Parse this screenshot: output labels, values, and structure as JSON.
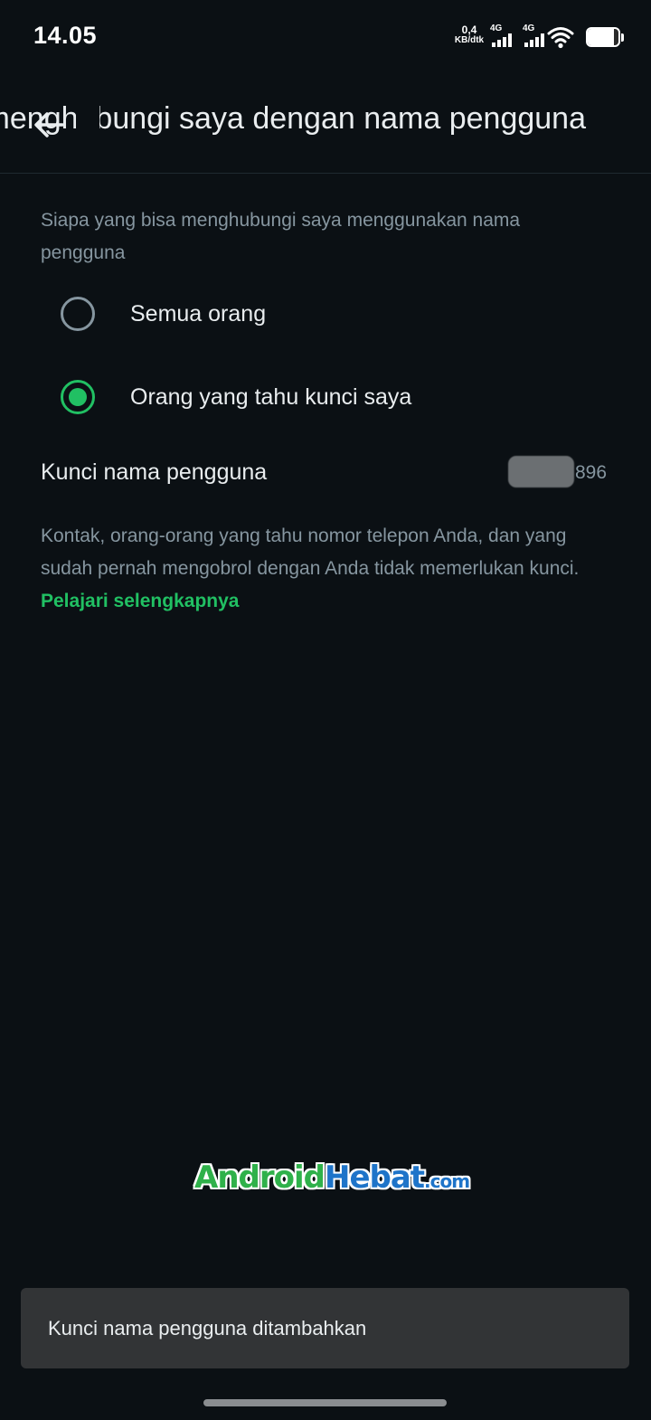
{
  "status_bar": {
    "time": "14.05",
    "net_speed_value": "0,4",
    "net_speed_unit": "KB/dtk",
    "sim1_label": "4G",
    "sim2_label": "4G",
    "battery_level_percent": 85
  },
  "app_bar": {
    "title": "Siapa yang bisa menghubungi saya dengan nama pengguna",
    "back_icon": "arrow-left-icon"
  },
  "section": {
    "description": "Siapa yang bisa menghubungi saya menggunakan nama pengguna",
    "options": [
      {
        "label": "Semua orang",
        "selected": false
      },
      {
        "label": "Orang yang tahu kunci saya",
        "selected": true
      }
    ]
  },
  "key": {
    "label": "Kunci nama pengguna",
    "value_suffix": "896"
  },
  "info": {
    "text": "Kontak, orang-orang yang tahu nomor telepon Anda, dan yang sudah pernah mengobrol dengan Anda tidak memerlukan kunci. ",
    "link": "Pelajari selengkapnya"
  },
  "watermark": {
    "part1": "Android",
    "part2": "Hebat",
    "part3": ".com"
  },
  "snackbar": {
    "message": "Kunci nama pengguna ditambahkan"
  },
  "colors": {
    "background": "#0b1014",
    "accent": "#21c063",
    "secondary_text": "#8696a0",
    "snackbar": "#323436"
  }
}
